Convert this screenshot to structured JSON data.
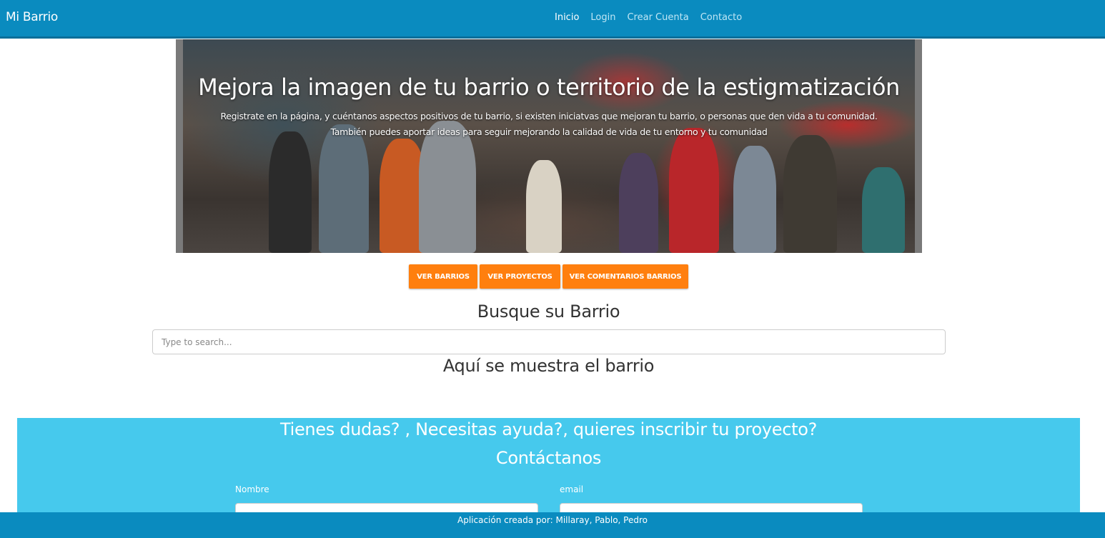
{
  "navbar": {
    "brand": "Mi Barrio",
    "links": [
      {
        "label": "Inicio",
        "active": true
      },
      {
        "label": "Login",
        "active": false
      },
      {
        "label": "Crear Cuenta",
        "active": false
      },
      {
        "label": "Contacto",
        "active": false
      }
    ]
  },
  "hero": {
    "title": "Mejora la imagen de tu barrio o territorio de la estigmatización",
    "text": "Registrate en la página, y cuéntanos aspectos positivos de tu barrio, si existen iniciatvas que mejoran tu barrio, o personas que den vida a tu comunidad. También puedes aportar ideas para seguir mejorando la calidad de vida de tu entorno y tu comunidad"
  },
  "buttons": {
    "barrios": "VER BARRIOS",
    "proyectos": "VER PROYECTOS",
    "comentarios": "VER COMENTARIOS BARRIOS"
  },
  "search": {
    "title": "Busque su Barrio",
    "placeholder": "Type to search...",
    "result_title": "Aquí se muestra el barrio"
  },
  "contact": {
    "question": "Tienes dudas? , Necesitas ayuda?, quieres inscribir tu proyecto?",
    "heading": "Contáctanos",
    "name_label": "Nombre",
    "email_label": "email"
  },
  "footer": {
    "text": "Aplicación creada por: Millaray, Pablo, Pedro"
  },
  "colors": {
    "navbar": "#0a8bbf",
    "button": "#ff7f0e",
    "contact_bg": "#46c9ed"
  }
}
